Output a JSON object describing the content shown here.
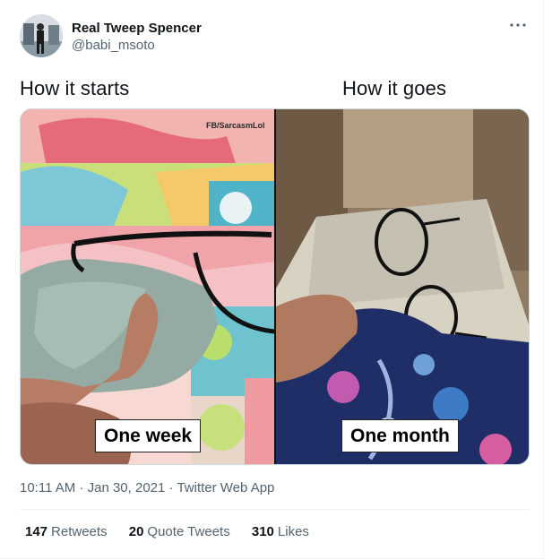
{
  "tweet": {
    "display_name": "Real Tweep Spencer",
    "handle": "@babi_msoto",
    "caption_left": "How it starts",
    "caption_right": "How it goes",
    "more_icon": "more-horizontal-icon",
    "media": {
      "watermark": "FB/SarcasmLol",
      "label_left": "One week",
      "label_right": "One month"
    },
    "time": "10:11 AM",
    "date": "Jan 30, 2021",
    "app": "Twitter Web App",
    "separator": "·",
    "stats": {
      "retweets_count": "147",
      "retweets_label": "Retweets",
      "quotes_count": "20",
      "quotes_label": "Quote Tweets",
      "likes_count": "310",
      "likes_label": "Likes"
    }
  },
  "colors": {
    "text_primary": "#0f1419",
    "text_secondary": "#536471",
    "border": "#eff3f4"
  }
}
